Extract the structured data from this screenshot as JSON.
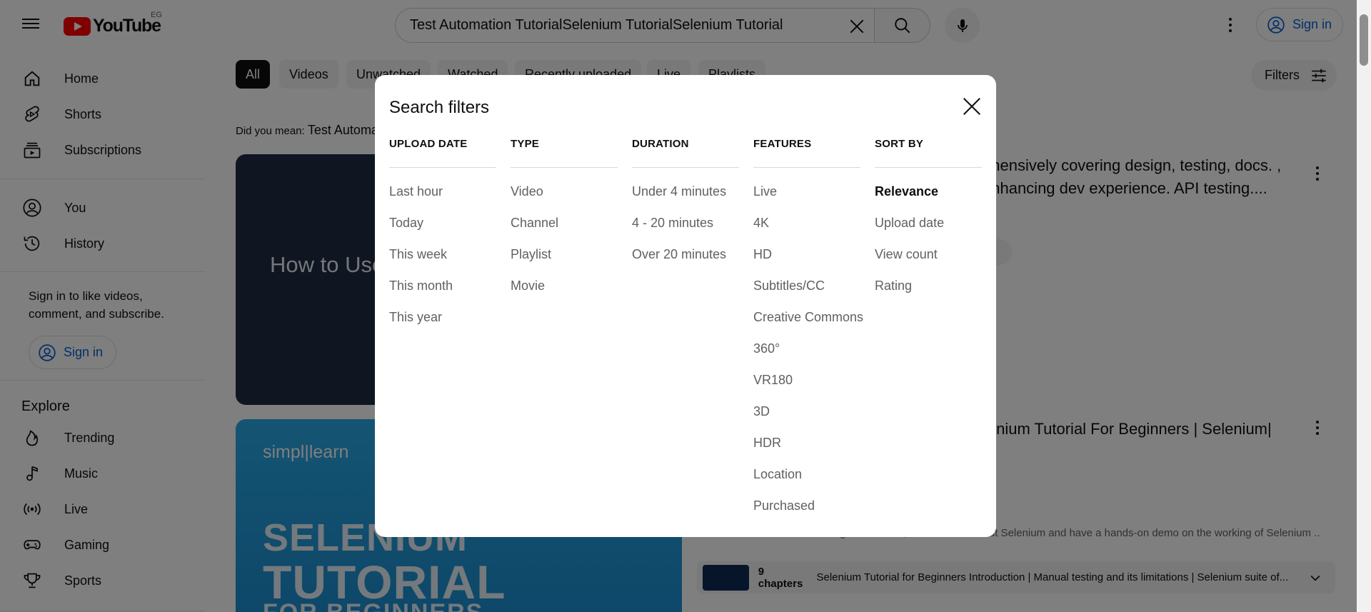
{
  "header": {
    "logo_text": "YouTube",
    "country": "EG",
    "search_value": "Test Automation TutorialSelenium TutorialSelenium Tutorial",
    "signin_label": "Sign in"
  },
  "sidebar": {
    "items_top": [
      {
        "label": "Home",
        "icon": "home-icon"
      },
      {
        "label": "Shorts",
        "icon": "shorts-icon"
      },
      {
        "label": "Subscriptions",
        "icon": "subscriptions-icon"
      }
    ],
    "items_you": [
      {
        "label": "You",
        "icon": "you-icon"
      },
      {
        "label": "History",
        "icon": "history-icon"
      }
    ],
    "signin_prompt": "Sign in to like videos, comment, and subscribe.",
    "signin_label": "Sign in",
    "explore_title": "Explore",
    "explore_items": [
      {
        "label": "Trending",
        "icon": "trending-icon"
      },
      {
        "label": "Music",
        "icon": "music-icon"
      },
      {
        "label": "Live",
        "icon": "live-icon"
      },
      {
        "label": "Gaming",
        "icon": "gaming-icon"
      },
      {
        "label": "Sports",
        "icon": "sports-icon"
      }
    ]
  },
  "chips": [
    "All",
    "Videos",
    "Unwatched",
    "Watched",
    "Recently uploaded",
    "Live",
    "Playlists"
  ],
  "filters_label": "Filters",
  "did_you_mean": {
    "prefix": "Did you mean:",
    "suggestion": "Test Automa"
  },
  "results": {
    "v1_thumb_text": "How to Use",
    "v1_desc": "ehensively covering design, testing, docs. , enhancing dev experience. API testing....",
    "v1_chip": "s",
    "v2_brand": "simpl|learn",
    "v2_thumb_line1": "SELENIUM",
    "v2_thumb_line2": "TUTORIAL",
    "v2_thumb_line3": "FOR BEGINNERS",
    "v2_title": "lenium Tutorial For Beginners | Selenium|",
    "v2_snippet": "In this Selenium tutorial for beginners video, we will learn about Selenium and have a hands-on demo on the working of Selenium ...",
    "v2_chapters_count": "9 chapters",
    "v2_chapters_text": "Selenium Tutorial for Beginners Introduction | Manual testing and its limitations | Selenium suite of..."
  },
  "modal": {
    "title": "Search filters",
    "columns": [
      {
        "heading": "UPLOAD DATE",
        "options": [
          "Last hour",
          "Today",
          "This week",
          "This month",
          "This year"
        ]
      },
      {
        "heading": "TYPE",
        "options": [
          "Video",
          "Channel",
          "Playlist",
          "Movie"
        ]
      },
      {
        "heading": "DURATION",
        "options": [
          "Under 4 minutes",
          "4 - 20 minutes",
          "Over 20 minutes"
        ]
      },
      {
        "heading": "FEATURES",
        "options": [
          "Live",
          "4K",
          "HD",
          "Subtitles/CC",
          "Creative Commons",
          "360°",
          "VR180",
          "3D",
          "HDR",
          "Location",
          "Purchased"
        ]
      },
      {
        "heading": "SORT BY",
        "options": [
          "Relevance",
          "Upload date",
          "View count",
          "Rating"
        ],
        "selected": "Relevance"
      }
    ]
  },
  "colors": {
    "brand_red": "#ff0000",
    "link_blue": "#065fd4"
  }
}
